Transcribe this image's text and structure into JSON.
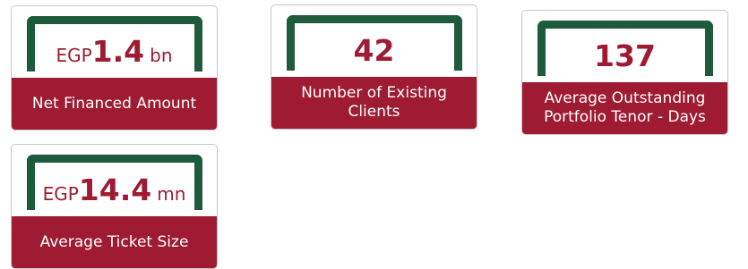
{
  "colors": {
    "accent": "#9e1b32",
    "bracket": "#1d5b3c",
    "label_text": "#ffffff"
  },
  "cards": [
    {
      "prefix": "EGP",
      "value": "1.4",
      "suffix": "bn",
      "label": "Net Financed Amount"
    },
    {
      "prefix": "",
      "value": "42",
      "suffix": "",
      "label": "Number of Existing Clients"
    },
    {
      "prefix": "",
      "value": "137",
      "suffix": "",
      "label": "Average Outstanding Portfolio Tenor - Days"
    },
    {
      "prefix": "EGP",
      "value": "14.4",
      "suffix": "mn",
      "label": "Average Ticket Size"
    }
  ]
}
